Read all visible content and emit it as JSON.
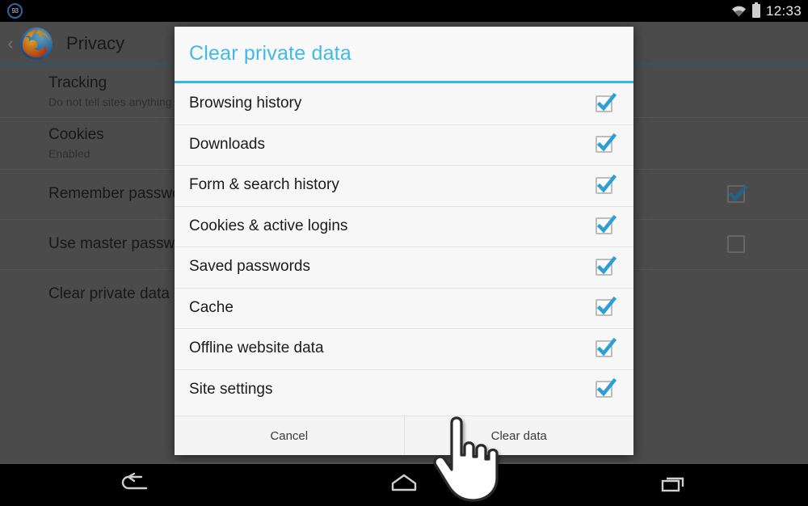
{
  "statusbar": {
    "notification_badge": "93",
    "notification_icon": "circle-badge-icon",
    "wifi_icon": "wifi-icon",
    "battery_icon": "battery-full-icon",
    "clock": "12:33"
  },
  "actionbar": {
    "back_icon": "back-chevron-icon",
    "app_icon": "firefox-logo-icon",
    "title": "Privacy"
  },
  "settings": {
    "items": [
      {
        "title": "Tracking",
        "subtitle": "Do not tell sites anything about my tracking preferences",
        "checkbox": null
      },
      {
        "title": "Cookies",
        "subtitle": "Enabled",
        "checkbox": null
      },
      {
        "title": "Remember passwords",
        "subtitle": "",
        "checkbox": true
      },
      {
        "title": "Use master password",
        "subtitle": "",
        "checkbox": false
      },
      {
        "title": "Clear private data",
        "subtitle": "",
        "checkbox": null
      }
    ]
  },
  "dialog": {
    "title": "Clear private data",
    "accent_color": "#33b5e5",
    "title_color": "#42b9e8",
    "items": [
      {
        "label": "Browsing history",
        "checked": true
      },
      {
        "label": "Downloads",
        "checked": true
      },
      {
        "label": "Form & search history",
        "checked": true
      },
      {
        "label": "Cookies & active logins",
        "checked": true
      },
      {
        "label": "Saved passwords",
        "checked": true
      },
      {
        "label": "Cache",
        "checked": true
      },
      {
        "label": "Offline website data",
        "checked": true
      },
      {
        "label": "Site settings",
        "checked": true
      }
    ],
    "cancel_label": "Cancel",
    "confirm_label": "Clear data"
  },
  "navbar": {
    "back_icon": "nav-back-icon",
    "home_icon": "nav-home-icon",
    "recents_icon": "nav-recents-icon"
  },
  "cursor": {
    "icon": "pointing-hand-cursor"
  }
}
